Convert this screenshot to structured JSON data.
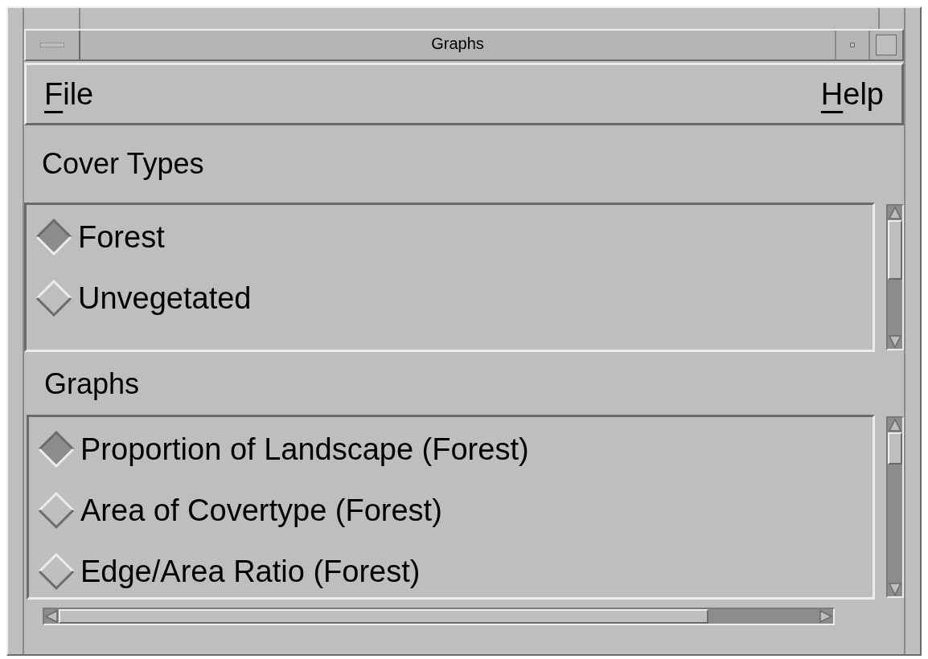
{
  "window": {
    "title": "Graphs"
  },
  "menu_bar": [
    {
      "label": "File"
    },
    {
      "label": "Help"
    }
  ],
  "cover_types": {
    "label": "Cover Types",
    "items": [
      {
        "label": "Forest",
        "selected": true
      },
      {
        "label": "Unvegetated",
        "selected": false
      }
    ]
  },
  "graphs": {
    "label": "Graphs",
    "items": [
      {
        "label": "Proportion of Landscape (Forest)",
        "selected": true
      },
      {
        "label": "Area of Covertype (Forest)",
        "selected": false
      },
      {
        "label": "Edge/Area Ratio (Forest)",
        "selected": false
      }
    ]
  }
}
